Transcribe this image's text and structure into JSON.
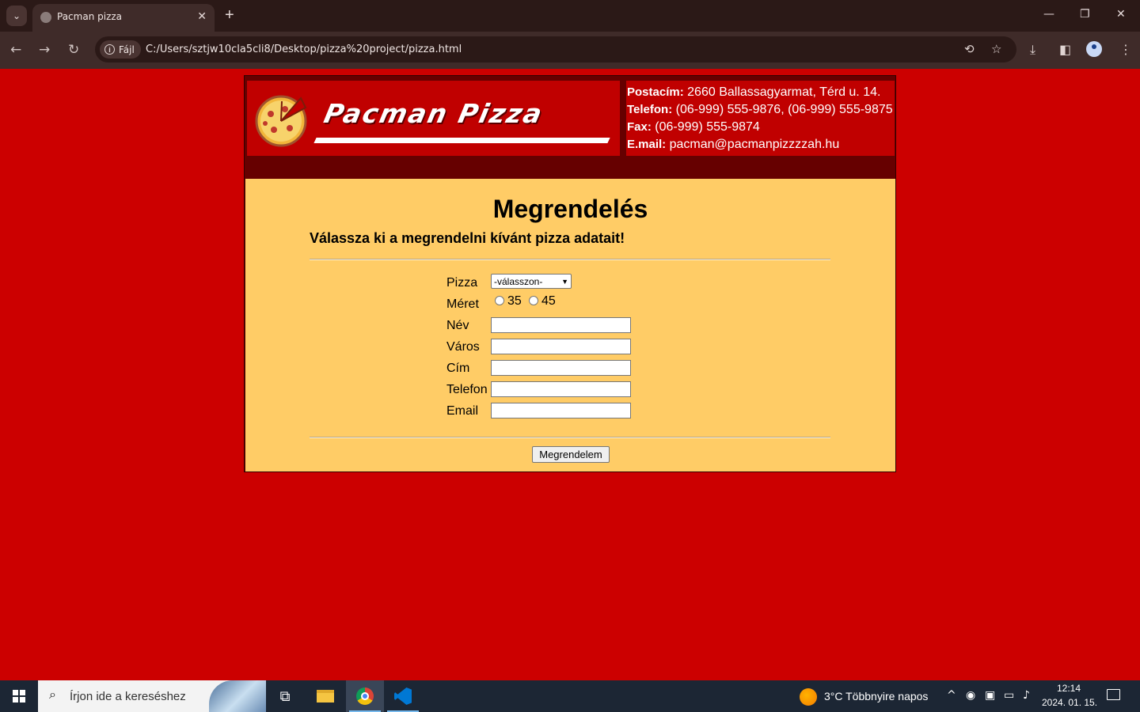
{
  "browser": {
    "tab_title": "Pacman pizza",
    "tab_close": "✕",
    "new_tab": "+",
    "site_chip": "Fájl",
    "url": "C:/Users/sztjw10cla5cli8/Desktop/pizza%20project/pizza.html",
    "window_controls": {
      "minimize": "—",
      "restore": "❐",
      "close": "✕"
    },
    "icons": [
      "back-icon",
      "forward-icon",
      "reload-icon",
      "translate-icon",
      "bookmark-star-icon",
      "download-icon",
      "side-panel-icon",
      "profile-icon",
      "menu-icon"
    ]
  },
  "header": {
    "logo_text": "Pacman  Pizza",
    "contact": {
      "postal_label": "Postacím:",
      "postal_value": " 2660 Ballassagyarmat, Térd u. 14.",
      "phone_label": "Telefon:",
      "phone_value": " (06-999) 555-9876, (06-999) 555-9875",
      "fax_label": "Fax:",
      "fax_value": " (06-999) 555-9874",
      "email_label": "E.mail:",
      "email_value": " pacman@pacmanpizzzzah.hu"
    }
  },
  "main": {
    "title": "Megrendelés",
    "subtitle": "Válassza ki a megrendelni kívánt pizza adatait!",
    "form": {
      "pizza_label": "Pizza",
      "pizza_selected": "-válasszon-",
      "size_label": "Méret",
      "size_options": [
        "35",
        "45"
      ],
      "name_label": "Név",
      "city_label": "Város",
      "address_label": "Cím",
      "phone_label": "Telefon",
      "email_label": "Email",
      "submit_label": "Megrendelem"
    }
  },
  "taskbar": {
    "search_placeholder": "Írjon ide a kereséshez",
    "weather": "3°C  Többnyire napos",
    "time": "12:14",
    "date": "2024. 01. 15."
  },
  "colors": {
    "page_background": "#cc0000",
    "header_dark": "#660000",
    "logo_panel": "#c00000",
    "content_background": "#ffcc66"
  }
}
